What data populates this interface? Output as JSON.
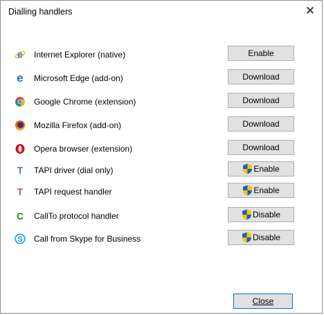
{
  "window": {
    "title": "Dialling handlers",
    "close_glyph": "✕"
  },
  "handlers": [
    {
      "label": "Internet Explorer (native)",
      "button": "Enable",
      "shield": false,
      "icon": "internet-explorer-icon"
    },
    {
      "label": "Microsoft Edge (add-on)",
      "button": "Download",
      "shield": false,
      "icon": "edge-icon"
    },
    {
      "label": "Google Chrome (extension)",
      "button": "Download",
      "shield": false,
      "icon": "chrome-icon"
    },
    {
      "label": "Mozilla Firefox (add-on)",
      "button": "Download",
      "shield": false,
      "icon": "firefox-icon"
    },
    {
      "label": "Opera browser (extension)",
      "button": "Download",
      "shield": false,
      "icon": "opera-icon"
    },
    {
      "label": "TAPI driver (dial only)",
      "button": "Enable",
      "shield": true,
      "icon": "tapi-driver-icon",
      "icon_text": "T",
      "icon_color": "#1a3a8c"
    },
    {
      "label": "TAPI request handler",
      "button": "Enable",
      "shield": true,
      "icon": "tapi-request-icon",
      "icon_text": "T",
      "icon_color": "#a01010"
    },
    {
      "label": "CallTo protocol handler",
      "button": "Disable",
      "shield": true,
      "icon": "callto-icon",
      "icon_text": "C",
      "icon_color": "#1f8a1f"
    },
    {
      "label": "Call from Skype for Business",
      "button": "Disable",
      "shield": true,
      "icon": "skype-icon",
      "icon_text": "S"
    }
  ],
  "footer": {
    "close_label": "Close"
  },
  "colors": {
    "button_face": "#e1e1e1",
    "button_border": "#adadad",
    "focus_border": "#0078d7",
    "shield_blue": "#1e5fb4",
    "shield_yellow": "#f6c400"
  }
}
